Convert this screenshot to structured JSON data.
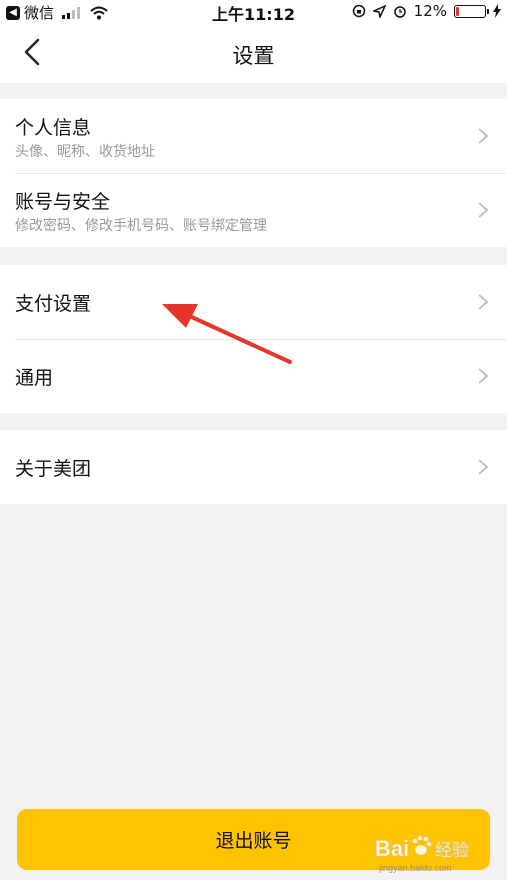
{
  "status_bar": {
    "app_back": "微信",
    "time": "上午11:12",
    "battery_pct": "12%",
    "battery_level": 0.12,
    "battery_color": "#e8342a"
  },
  "nav": {
    "title": "设置",
    "back_icon": "chevron-left-icon"
  },
  "groups": [
    {
      "items": [
        {
          "title": "个人信息",
          "subtitle": "头像、昵称、收货地址"
        },
        {
          "title": "账号与安全",
          "subtitle": "修改密码、修改手机号码、账号绑定管理"
        }
      ]
    },
    {
      "items": [
        {
          "title": "支付设置"
        },
        {
          "title": "通用"
        }
      ]
    },
    {
      "items": [
        {
          "title": "关于美团"
        }
      ]
    }
  ],
  "logout": {
    "label": "退出账号",
    "color": "#ffc300"
  },
  "annotation": {
    "type": "red-arrow",
    "color": "#e8342a",
    "points_to": "支付设置"
  },
  "watermark": {
    "text": "Bai",
    "text2": "经验",
    "url": "jingyan.baidu.com"
  }
}
